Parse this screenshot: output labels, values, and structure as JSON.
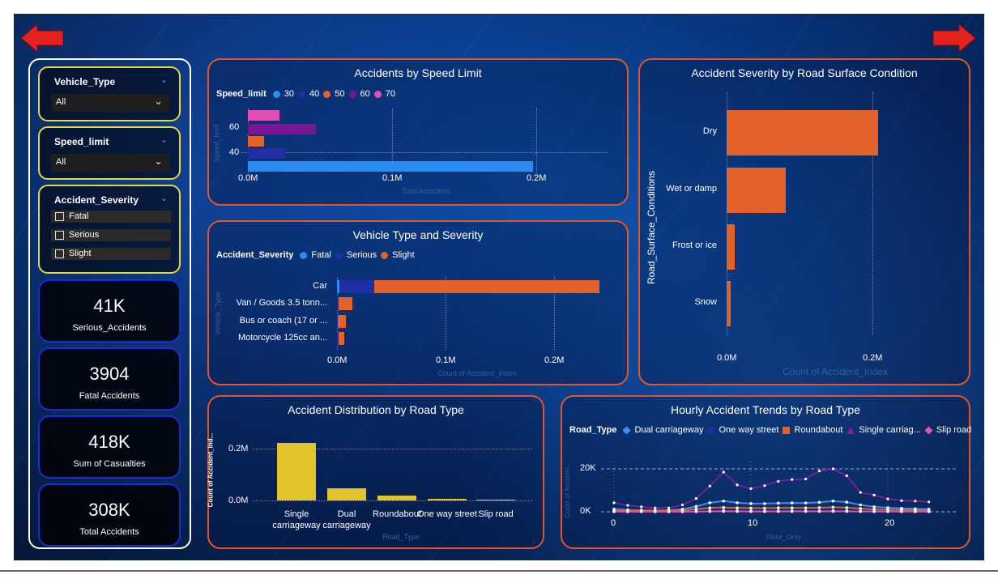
{
  "nav": {
    "back_icon": "left-arrow-icon",
    "forward_icon": "right-arrow-icon",
    "arrow_color": "#e5201d"
  },
  "filters": {
    "vehicle_type": {
      "title": "Vehicle_Type",
      "value": "All"
    },
    "speed_limit": {
      "title": "Speed_limit",
      "value": "All"
    },
    "accident_severity": {
      "title": "Accident_Severity",
      "options": [
        "Fatal",
        "Serious",
        "Slight"
      ]
    }
  },
  "kpis": [
    {
      "value": "41K",
      "label": "Serious_Accidents"
    },
    {
      "value": "3904",
      "label": "Fatal Accidents"
    },
    {
      "value": "418K",
      "label": "Sum of Casualties"
    },
    {
      "value": "308K",
      "label": "Total Accidents"
    }
  ],
  "colors": {
    "panel_border": "#e2552a",
    "slicer_border": "#e4d83a",
    "kpi_border": "#1c2bd8",
    "accent_orange": "#e2622a",
    "bar_yellow": "#e2c32c"
  },
  "chart_data": [
    {
      "type": "bar",
      "orientation": "horizontal",
      "title": "Accidents by Speed Limit",
      "legend_title": "Speed_limit",
      "categories": [
        "70",
        "60",
        "50",
        "40",
        "30"
      ],
      "values": [
        22000,
        47000,
        11000,
        26000,
        198000
      ],
      "colors": [
        "#e14fb4",
        "#7a1596",
        "#e2622a",
        "#1f2ea6",
        "#2a8bf0"
      ],
      "legend": [
        {
          "label": "30",
          "color": "#2a8bf0"
        },
        {
          "label": "40",
          "color": "#1f2ea6"
        },
        {
          "label": "50",
          "color": "#e2622a"
        },
        {
          "label": "60",
          "color": "#7a1596"
        },
        {
          "label": "70",
          "color": "#e14fb4"
        }
      ],
      "ytick_labels": [
        "60",
        "40"
      ],
      "xticks": [
        "0.0M",
        "0.1M",
        "0.2M"
      ],
      "xlabel": "Total Accidents",
      "ylabel": "Speed_limit",
      "xlim": [
        0,
        250000
      ],
      "grid": true
    },
    {
      "type": "bar",
      "orientation": "horizontal",
      "stacked": true,
      "title": "Vehicle Type and Severity",
      "legend_title": "Accident_Severity",
      "categories": [
        "Car",
        "Van / Goods 3.5 tonn...",
        "Bus or coach (17 or ...",
        "Motorcycle 125cc an..."
      ],
      "series": [
        {
          "name": "Fatal",
          "color": "#2a8bf0",
          "values": [
            2500,
            150,
            100,
            110
          ]
        },
        {
          "name": "Serious",
          "color": "#1f2ea6",
          "values": [
            32000,
            1200,
            900,
            1300
          ]
        },
        {
          "name": "Slight",
          "color": "#e2622a",
          "values": [
            207000,
            13000,
            7000,
            5000
          ]
        }
      ],
      "xticks": [
        "0.0M",
        "0.1M",
        "0.2M"
      ],
      "xlabel": "Count of Accident_Index",
      "ylabel": "Vehicle_Type",
      "xlim": [
        0,
        250000
      ],
      "grid": true
    },
    {
      "type": "bar",
      "orientation": "horizontal",
      "title": "Accident Severity by Road Surface Condition",
      "categories": [
        "Dry",
        "Wet or damp",
        "Frost or ice",
        "Snow"
      ],
      "values": [
        208000,
        81000,
        11500,
        5500
      ],
      "color": "#e2622a",
      "xticks": [
        "0.0M",
        "0.2M"
      ],
      "xlabel": "Count of Accident_Index",
      "ylabel": "Road_Surface_Conditions",
      "xlim": [
        0,
        250000
      ],
      "grid": true
    },
    {
      "type": "bar",
      "orientation": "vertical",
      "title": "Accident Distribution by Road Type",
      "categories": [
        "Single carriageway",
        "Dual carriageway",
        "Roundabout",
        "One way street",
        "Slip road"
      ],
      "values": [
        230000,
        47000,
        20000,
        6000,
        3000
      ],
      "color": "#e2c32c",
      "yticks": [
        "0.2M",
        "0.0M"
      ],
      "xlabel": "Road_Type",
      "ylabel": "Count of Accident_Ind...",
      "ylim": [
        0,
        260000
      ],
      "grid": true
    },
    {
      "type": "line",
      "title": "Hourly Accident Trends by Road Type",
      "legend_title": "Road_Type",
      "x": [
        0,
        1,
        2,
        3,
        4,
        5,
        6,
        7,
        8,
        9,
        10,
        11,
        12,
        13,
        14,
        15,
        16,
        17,
        18,
        19,
        20,
        21,
        22,
        23
      ],
      "series": [
        {
          "name": "Dual carriageway",
          "legend_label": "Dual carriageway",
          "color": "#3a8ef5",
          "values": [
            1200,
            900,
            700,
            600,
            700,
            1200,
            2500,
            4200,
            5000,
            4200,
            3800,
            3800,
            4000,
            4100,
            4100,
            4400,
            5000,
            4500,
            3200,
            2300,
            1900,
            1600,
            1400,
            1200
          ]
        },
        {
          "name": "One way street",
          "legend_label": "One way street",
          "color": "#1f2ea6",
          "values": [
            150,
            120,
            100,
            80,
            80,
            100,
            200,
            400,
            500,
            400,
            350,
            350,
            380,
            380,
            380,
            420,
            480,
            430,
            320,
            250,
            220,
            190,
            170,
            160
          ]
        },
        {
          "name": "Roundabout",
          "legend_label": "Roundabout",
          "color": "#e2622a",
          "values": [
            800,
            600,
            450,
            400,
            450,
            700,
            1200,
            1800,
            2000,
            1800,
            1700,
            1700,
            1800,
            1800,
            1800,
            1900,
            2100,
            1900,
            1500,
            1100,
            950,
            850,
            750,
            700
          ]
        },
        {
          "name": "Single carriageway",
          "legend_label": "Single carriag...",
          "color": "#8a1ca4",
          "values": [
            4200,
            3000,
            2300,
            1800,
            1800,
            3200,
            6200,
            12000,
            18500,
            12500,
            10800,
            12200,
            14200,
            15000,
            15300,
            19000,
            20000,
            16800,
            9000,
            7800,
            6000,
            5200,
            5000,
            4600
          ]
        },
        {
          "name": "Slip road",
          "legend_label": "Slip road",
          "color": "#e14fb4",
          "values": [
            80,
            60,
            50,
            40,
            40,
            60,
            100,
            180,
            220,
            180,
            160,
            160,
            170,
            170,
            170,
            190,
            220,
            200,
            150,
            120,
            100,
            90,
            85,
            80
          ]
        }
      ],
      "xticks": [
        "0",
        "10",
        "20"
      ],
      "yticks": [
        "20K",
        "0K"
      ],
      "xlabel": "Hour_Only",
      "ylabel": "Count of Accident...",
      "ylim": [
        0,
        25000
      ],
      "grid": true
    }
  ]
}
